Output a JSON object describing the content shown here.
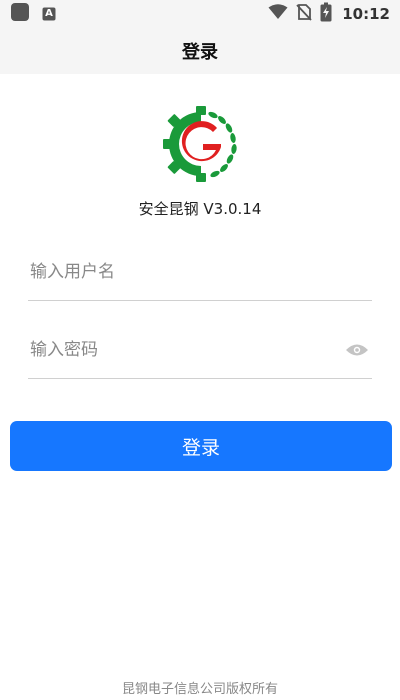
{
  "status_bar": {
    "time": "10:12",
    "icons": [
      "app-square-icon",
      "a-letter-icon",
      "wifi-icon",
      "no-sim-icon",
      "battery-charging-icon"
    ],
    "a_letter": "A"
  },
  "app_bar": {
    "title": "登录"
  },
  "logo": {
    "letter": "G",
    "colors": {
      "green": "#1a9a3a",
      "red": "#e02020"
    }
  },
  "version": "安全昆钢 V3.0.14",
  "form": {
    "username_placeholder": "输入用户名",
    "username_value": "",
    "password_placeholder": "输入密码",
    "password_value": ""
  },
  "login_button": {
    "label": "登录",
    "color": "#1677ff"
  },
  "footer": "昆钢电子信息公司版权所有"
}
